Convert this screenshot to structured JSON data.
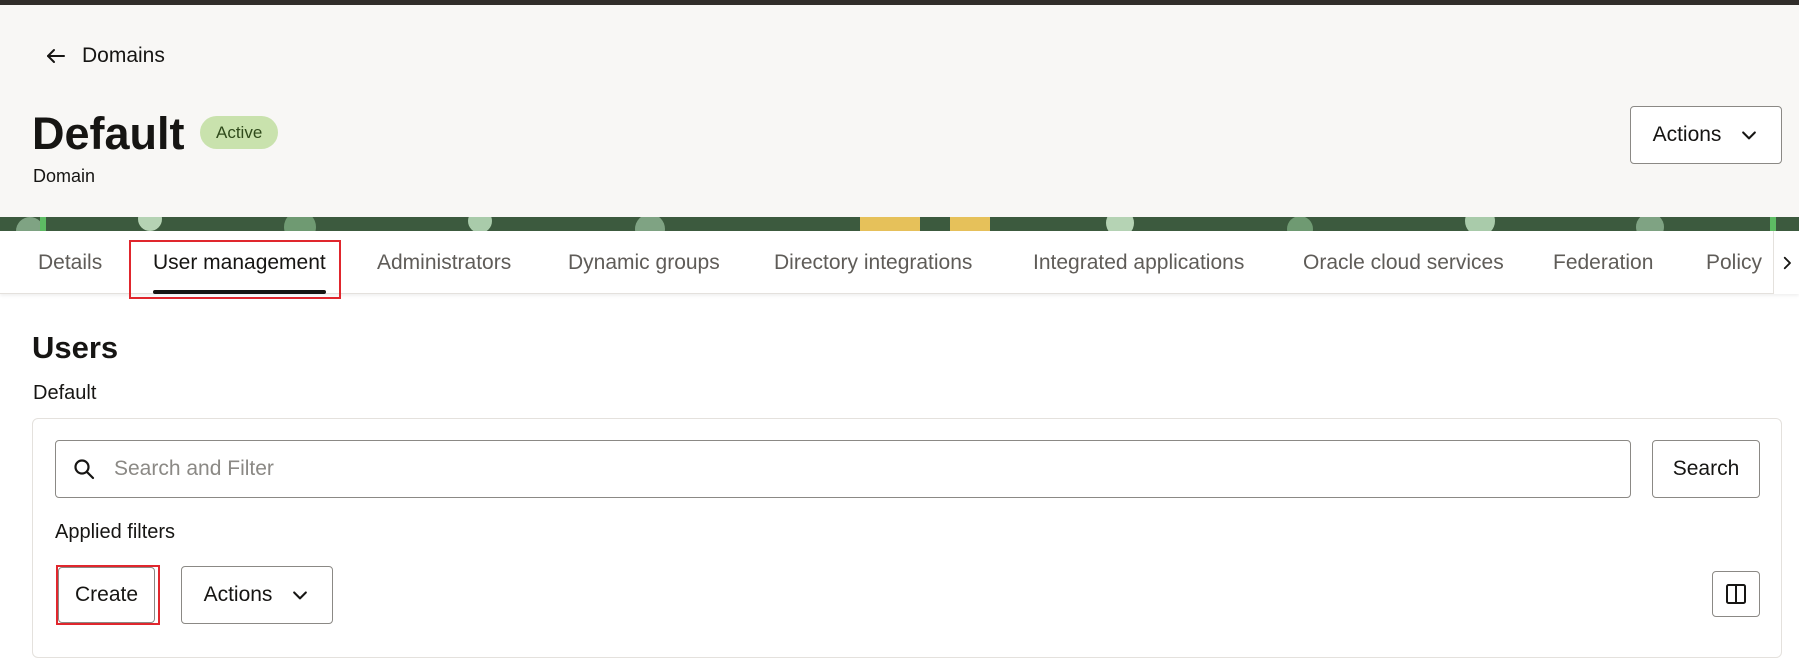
{
  "breadcrumb": {
    "back_label": "Domains"
  },
  "header": {
    "title": "Default",
    "status_badge": "Active",
    "subtitle": "Domain",
    "actions_label": "Actions"
  },
  "tabs": [
    {
      "label": "Details",
      "active": false
    },
    {
      "label": "User management",
      "active": true
    },
    {
      "label": "Administrators",
      "active": false
    },
    {
      "label": "Dynamic groups",
      "active": false
    },
    {
      "label": "Directory integrations",
      "active": false
    },
    {
      "label": "Integrated applications",
      "active": false
    },
    {
      "label": "Oracle cloud services",
      "active": false
    },
    {
      "label": "Federation",
      "active": false
    },
    {
      "label": "Policy",
      "active": false
    }
  ],
  "section": {
    "title": "Users",
    "subtitle": "Default"
  },
  "search": {
    "placeholder": "Search and Filter",
    "value": "",
    "button_label": "Search"
  },
  "filters": {
    "label": "Applied filters"
  },
  "toolbar": {
    "create_label": "Create",
    "actions_label": "Actions"
  },
  "colors": {
    "highlight": "#e0262d",
    "badge_bg": "#c9e2ad",
    "header_bg": "#f8f7f5"
  }
}
